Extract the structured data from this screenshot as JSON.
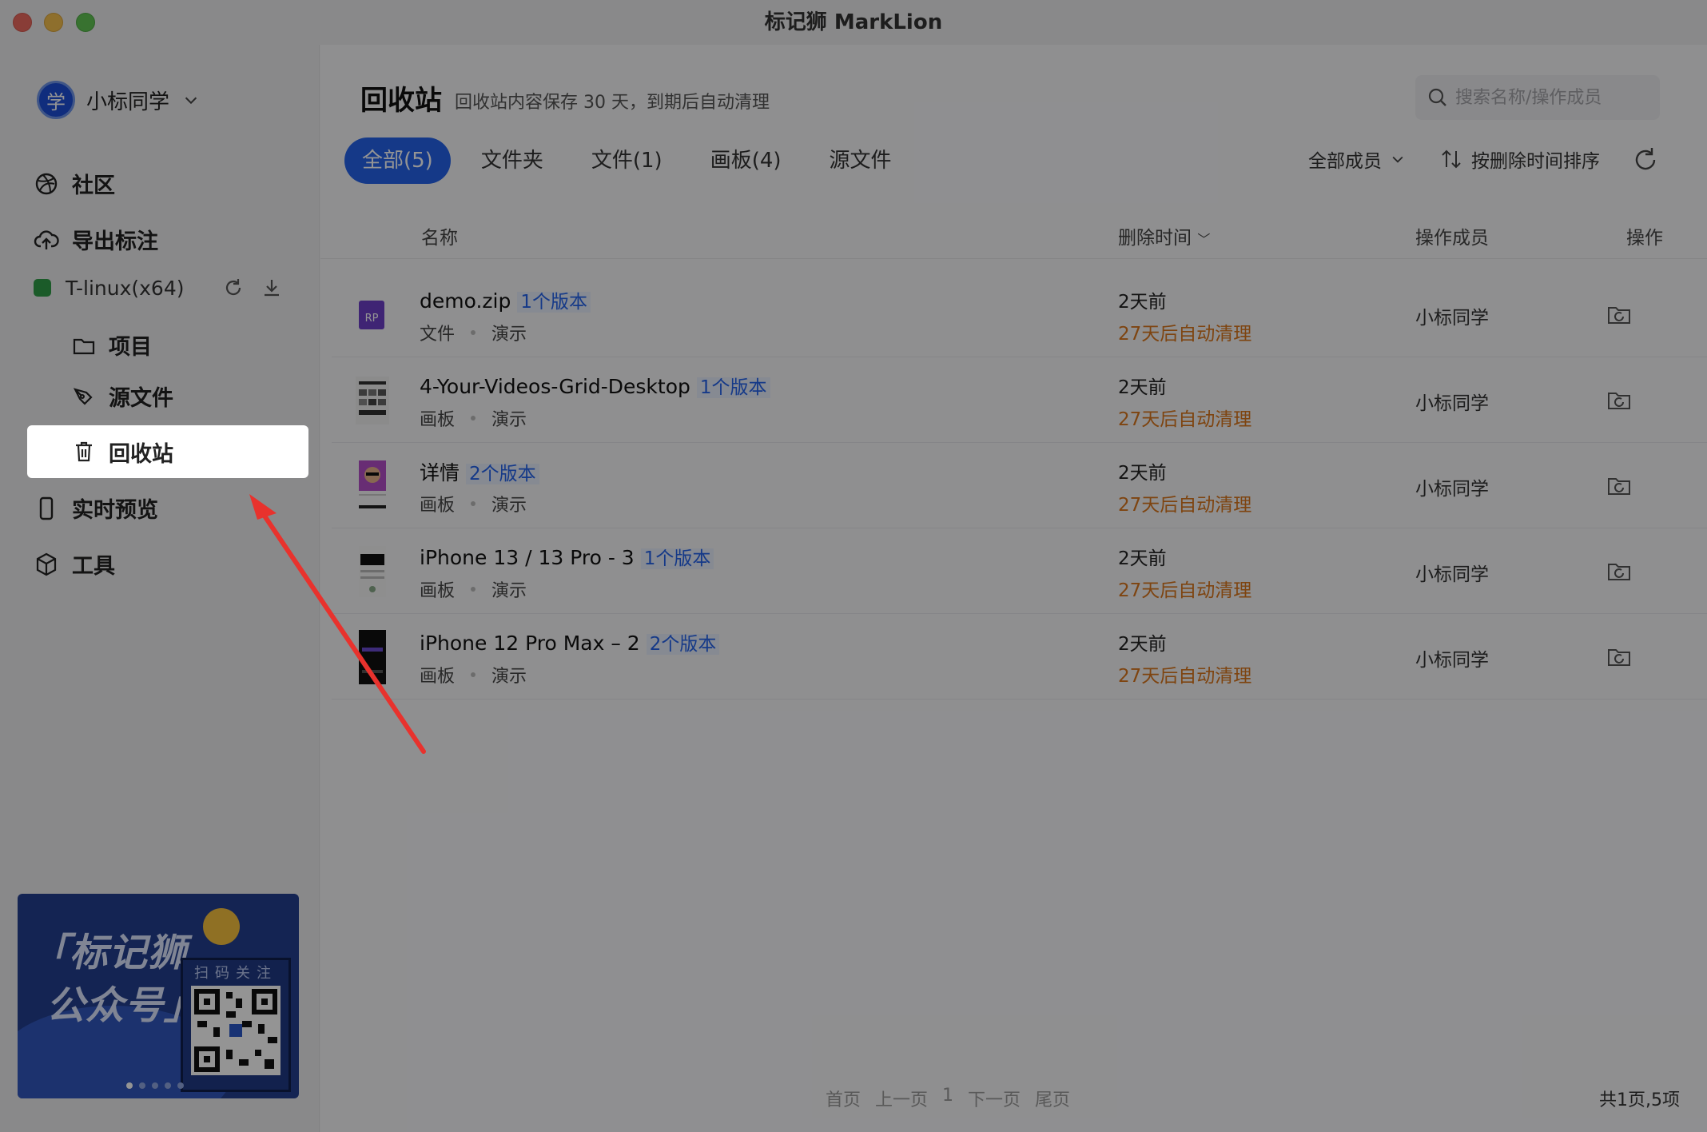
{
  "window": {
    "title": "标记狮 MarkLion"
  },
  "sidebar": {
    "user": {
      "avatar_text": "学",
      "name": "小标同学"
    },
    "nav": [
      {
        "label": "社区",
        "icon": "dribbble-icon"
      },
      {
        "label": "导出标注",
        "icon": "cloud-upload-icon"
      }
    ],
    "team": {
      "name": "T-linux(x64)",
      "color": "#2f9d47"
    },
    "sub_items": [
      {
        "label": "项目",
        "icon": "folder-icon"
      },
      {
        "label": "源文件",
        "icon": "pen-icon"
      },
      {
        "label": "回收站",
        "icon": "trash-icon"
      }
    ],
    "nav2": [
      {
        "label": "实时预览",
        "icon": "phone-icon"
      },
      {
        "label": "工具",
        "icon": "cube-icon"
      }
    ],
    "promo": {
      "line1": "「标记狮",
      "line2": "公众号」",
      "qr_label": "扫码关注"
    }
  },
  "main": {
    "title": "回收站",
    "subtitle": "回收站内容保存 30 天，到期后自动清理",
    "search_placeholder": "搜索名称/操作成员",
    "tabs": [
      {
        "label": "全部(5)",
        "active": true
      },
      {
        "label": "文件夹",
        "active": false
      },
      {
        "label": "文件(1)",
        "active": false
      },
      {
        "label": "画板(4)",
        "active": false
      },
      {
        "label": "源文件",
        "active": false
      }
    ],
    "member_filter": "全部成员",
    "sort_label": "按删除时间排序",
    "columns": {
      "name": "名称",
      "deleted_time": "删除时间",
      "operator": "操作成员",
      "action": "操作"
    },
    "rows": [
      {
        "name": "demo.zip",
        "versions": "1个版本",
        "type": "文件",
        "project": "演示",
        "time": "2天前",
        "clean": "27天后自动清理",
        "user": "小标同学"
      },
      {
        "name": "4-Your-Videos-Grid-Desktop",
        "versions": "1个版本",
        "type": "画板",
        "project": "演示",
        "time": "2天前",
        "clean": "27天后自动清理",
        "user": "小标同学"
      },
      {
        "name": "详情",
        "versions": "2个版本",
        "type": "画板",
        "project": "演示",
        "time": "2天前",
        "clean": "27天后自动清理",
        "user": "小标同学"
      },
      {
        "name": "iPhone 13 / 13 Pro - 3",
        "versions": "1个版本",
        "type": "画板",
        "project": "演示",
        "time": "2天前",
        "clean": "27天后自动清理",
        "user": "小标同学"
      },
      {
        "name": "iPhone 12 Pro Max – 2",
        "versions": "2个版本",
        "type": "画板",
        "project": "演示",
        "time": "2天前",
        "clean": "27天后自动清理",
        "user": "小标同学"
      }
    ],
    "pager": {
      "first": "首页",
      "prev": "上一页",
      "current": "1",
      "next": "下一页",
      "last": "尾页"
    },
    "total": "共1页,5项"
  },
  "colors": {
    "accent": "#2563eb",
    "warning": "#d9761c",
    "annotation_arrow": "#e8322d"
  }
}
